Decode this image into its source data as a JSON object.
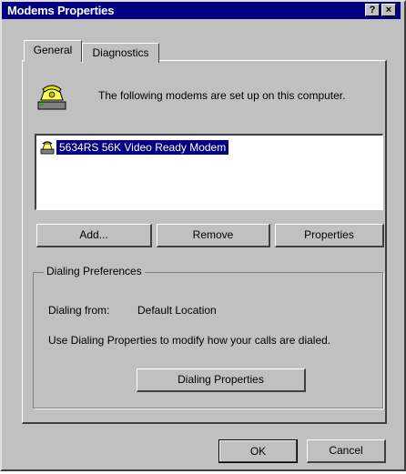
{
  "window": {
    "title": "Modems Properties",
    "help_label": "?",
    "close_label": "×"
  },
  "tabs": [
    {
      "label": "General",
      "selected": true
    },
    {
      "label": "Diagnostics",
      "selected": false
    }
  ],
  "general": {
    "intro_text": "The following modems are set up on this computer.",
    "modems": [
      {
        "label": "5634RS 56K Video Ready Modem",
        "selected": true
      }
    ],
    "buttons": {
      "add": "Add...",
      "remove": "Remove",
      "properties": "Properties"
    },
    "dialing_preferences": {
      "group_label": "Dialing Preferences",
      "dialing_from_label": "Dialing from:",
      "dialing_from_value": "Default Location",
      "description": "Use Dialing Properties to modify how your calls are dialed.",
      "button": "Dialing Properties"
    }
  },
  "footer": {
    "ok": "OK",
    "cancel": "Cancel"
  },
  "colors": {
    "face": "#c0c0c0",
    "titlebar": "#000080",
    "selection": "#000080"
  }
}
